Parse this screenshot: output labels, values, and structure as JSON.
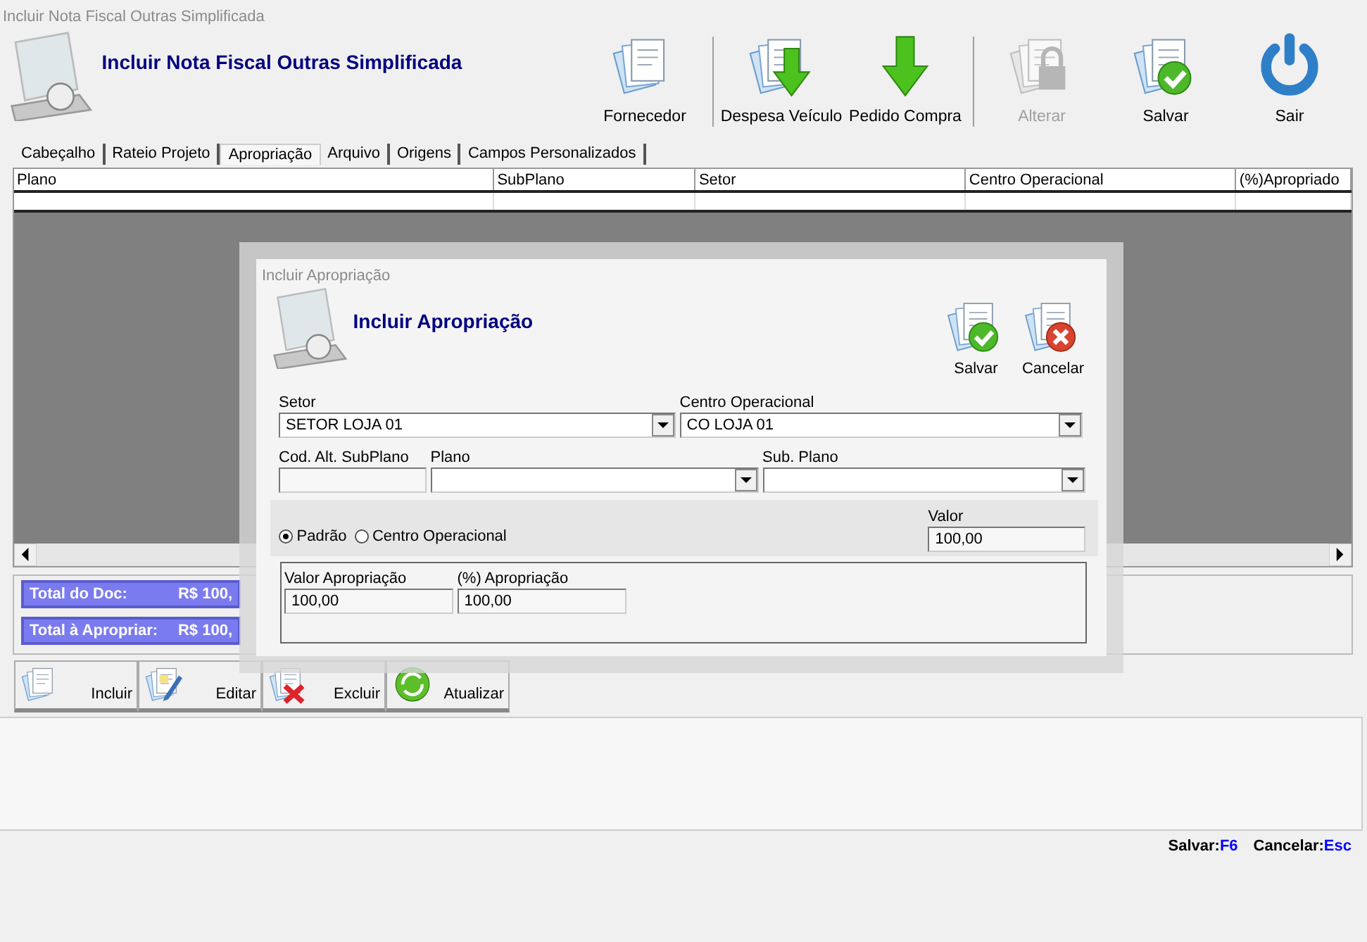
{
  "window": {
    "title": "Incluir Nota Fiscal Outras Simplificada"
  },
  "header": {
    "title": "Incluir Nota Fiscal Outras Simplificada"
  },
  "toolbar": {
    "groups": [
      [
        {
          "label": "Fornecedor",
          "disabled": false
        }
      ],
      [
        {
          "label": "Despesa Veículo",
          "disabled": false
        },
        {
          "label": "Pedido Compra",
          "disabled": false
        }
      ],
      [
        {
          "label": "Alterar",
          "disabled": true
        },
        {
          "label": "Salvar",
          "disabled": false
        },
        {
          "label": "Sair",
          "disabled": false
        }
      ]
    ]
  },
  "tabs": [
    {
      "label": "Cabeçalho",
      "selected": false
    },
    {
      "label": "Rateio Projeto",
      "selected": false
    },
    {
      "label": "Apropriação",
      "selected": true
    },
    {
      "label": "Arquivo",
      "selected": false
    },
    {
      "label": "Origens",
      "selected": false
    },
    {
      "label": "Campos Personalizados",
      "selected": false
    }
  ],
  "grid": {
    "columns": [
      "Plano",
      "SubPlano",
      "Setor",
      "Centro Operacional",
      "(%)Apropriado"
    ]
  },
  "totals": [
    {
      "label": "Total do Doc:",
      "value": "R$ 100,"
    },
    {
      "label": "Total à Apropriar:",
      "value": "R$ 100,"
    }
  ],
  "actions": [
    {
      "label": "Incluir"
    },
    {
      "label": "Editar"
    },
    {
      "label": "Excluir"
    },
    {
      "label": "Atualizar"
    }
  ],
  "status_bar": [
    {
      "label": "Salvar:",
      "key": "F6"
    },
    {
      "label": "Cancelar:",
      "key": "Esc"
    }
  ],
  "dialog": {
    "window_title": "Incluir Apropriação",
    "title": "Incluir Apropriação",
    "buttons": [
      {
        "label": "Salvar"
      },
      {
        "label": "Cancelar"
      }
    ],
    "field_rows": [
      [
        {
          "label": "Setor",
          "value": "SETOR LOJA 01",
          "kind": "select"
        },
        {
          "label": "Centro Operacional",
          "value": "CO LOJA 01",
          "kind": "select"
        }
      ],
      [
        {
          "label": "Cod. Alt. SubPlano",
          "kind": "input"
        },
        {
          "label": "Plano",
          "kind": "select"
        },
        {
          "label": "Sub. Plano",
          "kind": "select"
        }
      ]
    ],
    "radios": [
      {
        "label": "Padrão",
        "selected": true
      },
      {
        "label": "Centro Operacional",
        "selected": false
      }
    ],
    "valor": {
      "label": "Valor",
      "value": "100,00"
    },
    "apropriacao": [
      {
        "label": "Valor Apropriação",
        "value": "100,00"
      },
      {
        "label": "(%) Apropriação",
        "value": "100,00"
      }
    ]
  }
}
